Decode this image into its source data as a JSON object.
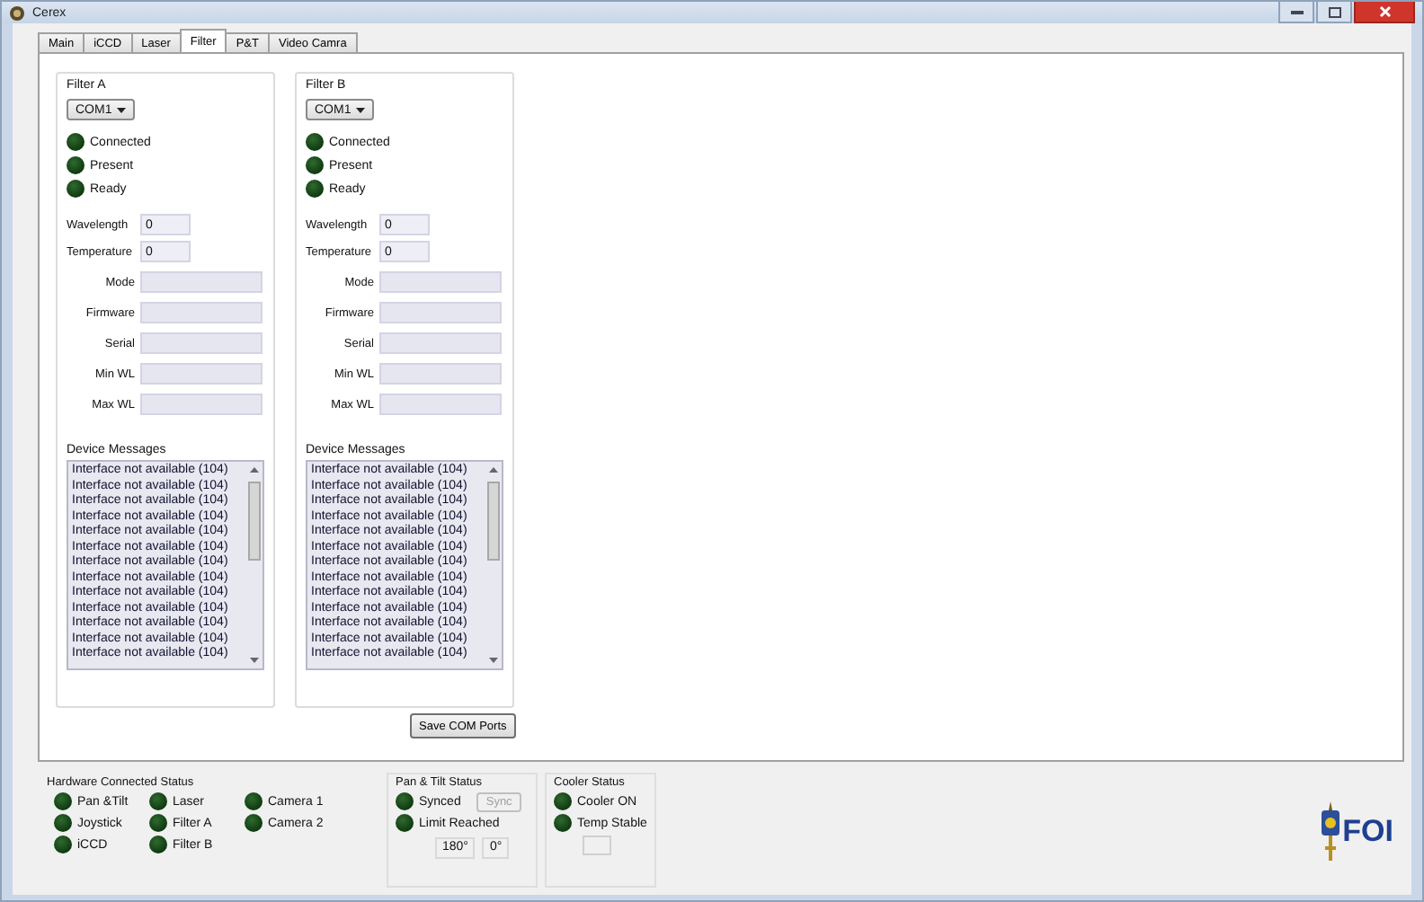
{
  "window": {
    "title": "Cerex"
  },
  "tabs": [
    {
      "label": "Main",
      "selected": false
    },
    {
      "label": "iCCD",
      "selected": false
    },
    {
      "label": "Laser",
      "selected": false
    },
    {
      "label": "Filter",
      "selected": true
    },
    {
      "label": "P&T",
      "selected": false
    },
    {
      "label": "Video Camra",
      "selected": false
    }
  ],
  "filters": [
    {
      "title": "Filter A",
      "port": "COM1",
      "indicators": [
        {
          "label": "Connected",
          "on": false
        },
        {
          "label": "Present",
          "on": false
        },
        {
          "label": "Ready",
          "on": false
        }
      ],
      "fields": [
        {
          "label": "Wavelength",
          "value": "0",
          "kind": "short"
        },
        {
          "label": "Temperature",
          "value": "0",
          "kind": "short"
        },
        {
          "label": "Mode",
          "kind": "long"
        },
        {
          "label": "Firmware",
          "kind": "long"
        },
        {
          "label": "Serial",
          "kind": "long"
        },
        {
          "label": "Min WL",
          "kind": "long"
        },
        {
          "label": "Max WL",
          "kind": "long"
        }
      ],
      "messages_label": "Device Messages",
      "messages": [
        "Interface not available (104)",
        "Interface not available (104)",
        "Interface not available (104)",
        "Interface not available (104)",
        "Interface not available (104)",
        "Interface not available (104)",
        "Interface not available (104)",
        "Interface not available (104)",
        "Interface not available (104)",
        "Interface not available (104)",
        "Interface not available (104)",
        "Interface not available (104)",
        "Interface not available (104)"
      ]
    },
    {
      "title": "Filter B",
      "port": "COM1",
      "indicators": [
        {
          "label": "Connected",
          "on": false
        },
        {
          "label": "Present",
          "on": false
        },
        {
          "label": "Ready",
          "on": false
        }
      ],
      "fields": [
        {
          "label": "Wavelength",
          "value": "0",
          "kind": "short"
        },
        {
          "label": "Temperature",
          "value": "0",
          "kind": "short"
        },
        {
          "label": "Mode",
          "kind": "long"
        },
        {
          "label": "Firmware",
          "kind": "long"
        },
        {
          "label": "Serial",
          "kind": "long"
        },
        {
          "label": "Min WL",
          "kind": "long"
        },
        {
          "label": "Max WL",
          "kind": "long"
        }
      ],
      "messages_label": "Device Messages",
      "messages": [
        "Interface not available (104)",
        "Interface not available (104)",
        "Interface not available (104)",
        "Interface not available (104)",
        "Interface not available (104)",
        "Interface not available (104)",
        "Interface not available (104)",
        "Interface not available (104)",
        "Interface not available (104)",
        "Interface not available (104)",
        "Interface not available (104)",
        "Interface not available (104)",
        "Interface not available (104)"
      ]
    }
  ],
  "save_button": "Save COM Ports",
  "hardware_status": {
    "title": "Hardware Connected Status",
    "columns": [
      [
        {
          "label": "Pan &Tilt",
          "on": false
        },
        {
          "label": "Joystick",
          "on": false
        },
        {
          "label": "iCCD",
          "on": false
        }
      ],
      [
        {
          "label": "Laser",
          "on": false
        },
        {
          "label": "Filter A",
          "on": false
        },
        {
          "label": "Filter B",
          "on": false
        }
      ],
      [
        {
          "label": "Camera 1",
          "on": false
        },
        {
          "label": "Camera 2",
          "on": false
        }
      ]
    ]
  },
  "pan_tilt_status": {
    "title": "Pan & Tilt Status",
    "indicators": [
      {
        "label": "Synced",
        "on": false
      },
      {
        "label": "Limit Reached",
        "on": false
      }
    ],
    "sync_button": {
      "label": "Sync",
      "disabled": true
    },
    "readouts": [
      "180°",
      "0°"
    ]
  },
  "cooler_status": {
    "title": "Cooler Status",
    "indicators": [
      {
        "label": "Cooler ON",
        "on": false
      },
      {
        "label": "Temp Stable",
        "on": false
      }
    ]
  },
  "logo": "FOI"
}
